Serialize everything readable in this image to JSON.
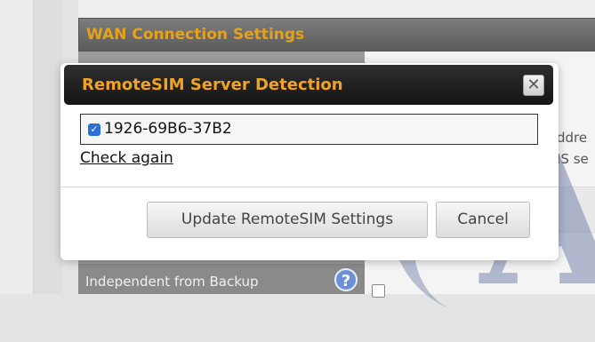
{
  "background": {
    "section_title": "WAN Connection Settings",
    "partial_text_1": "ddre",
    "partial_text_2": "IS se",
    "bottom_row_label": "Independent from Backup",
    "help_icon_glyph": "?",
    "watermark_letter": "A"
  },
  "dialog": {
    "title": "RemoteSIM Server Detection",
    "close_glyph": "✕",
    "device": {
      "checked": true,
      "check_glyph": "✓",
      "label": "1926-69B6-37B2"
    },
    "check_again_label": "Check again",
    "update_button_label": "Update RemoteSIM Settings",
    "cancel_button_label": "Cancel"
  },
  "colors": {
    "title_accent": "#f1a31d",
    "checkbox_blue": "#2a6ddb",
    "help_blue": "#6d8fd6"
  }
}
